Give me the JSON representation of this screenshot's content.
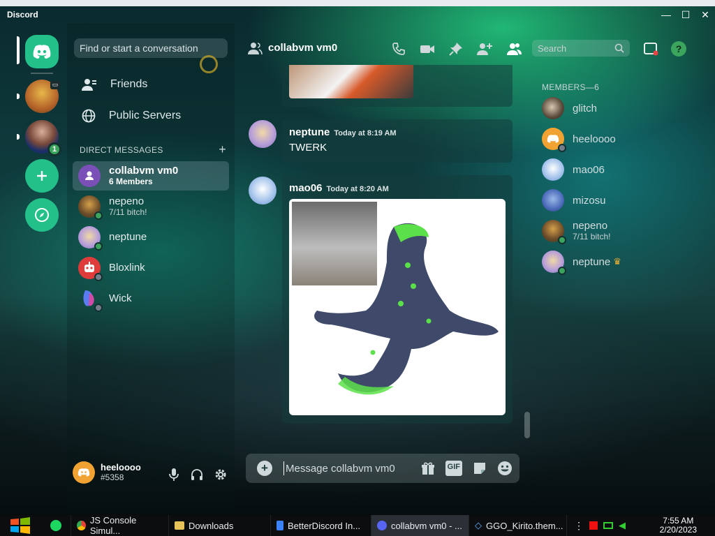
{
  "app": {
    "title": "Discord"
  },
  "window": {
    "minimize": "—",
    "maximize": "☐",
    "close": "✕"
  },
  "sidebar": {
    "search_placeholder": "Find or start a conversation",
    "nav": [
      {
        "label": "Friends"
      },
      {
        "label": "Public Servers"
      }
    ],
    "dm_header": "DIRECT MESSAGES",
    "dm_add": "+",
    "dms": [
      {
        "name": "collabvm vm0",
        "sub": "6 Members"
      },
      {
        "name": "nepeno",
        "sub": "7/11 bitch!"
      },
      {
        "name": "neptune",
        "sub": ""
      },
      {
        "name": "Bloxlink",
        "sub": ""
      },
      {
        "name": "Wick",
        "sub": ""
      }
    ]
  },
  "servers": {
    "badge": "1"
  },
  "user": {
    "name": "heeloooo",
    "tag": "#5358"
  },
  "channel": {
    "name": "collabvm vm0",
    "search_placeholder": "Search"
  },
  "messages": [
    {
      "author": "neptune",
      "time": "Today at 8:19 AM",
      "text": "TWERK"
    },
    {
      "author": "mao06",
      "time": "Today at 8:20 AM",
      "text": ""
    }
  ],
  "composer": {
    "placeholder": "Message collabvm vm0",
    "gif_label": "GIF"
  },
  "members": {
    "header": "MEMBERS—6",
    "list": [
      {
        "name": "glitch",
        "sub": ""
      },
      {
        "name": "heeloooo",
        "sub": ""
      },
      {
        "name": "mao06",
        "sub": ""
      },
      {
        "name": "mizosu",
        "sub": ""
      },
      {
        "name": "nepeno",
        "sub": "7/11 bitch!"
      },
      {
        "name": "neptune",
        "sub": ""
      }
    ]
  },
  "taskbar": {
    "items": [
      {
        "label": "JS Console Simul..."
      },
      {
        "label": "Downloads"
      },
      {
        "label": "BetterDiscord In..."
      },
      {
        "label": "collabvm vm0 - ..."
      },
      {
        "label": "GGO_Kirito.them..."
      }
    ],
    "time": "7:55 AM",
    "date": "2/20/2023"
  },
  "colors": {
    "accent": "#23c08a",
    "online": "#3ba55d",
    "offline": "#747f8d",
    "blurple": "#5865f2",
    "badge": "#3ba55d"
  },
  "icons": [
    "discord-logo-icon",
    "friends-icon",
    "globe-icon",
    "add-server-icon",
    "explore-icon",
    "mic-icon",
    "headphones-icon",
    "settings-icon",
    "call-icon",
    "video-icon",
    "pin-icon",
    "add-friend-icon",
    "members-icon",
    "search-icon",
    "inbox-icon",
    "help-icon",
    "attach-icon",
    "gift-icon",
    "sticker-icon",
    "emoji-icon",
    "crown-icon"
  ]
}
